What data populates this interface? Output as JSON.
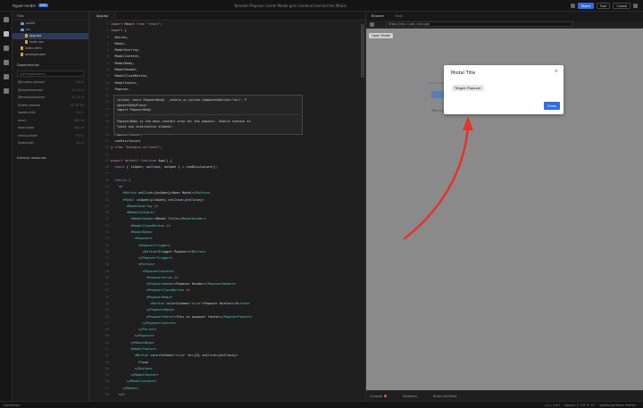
{
  "topbar": {
    "project": "Hyper-rendel",
    "badge": "DEV",
    "center_title": "Tomodel Popover inside Modal gets rendered behind the Modal",
    "share": "Share",
    "fork": "Fork",
    "create": "Create"
  },
  "sidebar": {
    "header": "Files",
    "tree": [
      {
        "label": "public",
        "type": "folder",
        "indent": 1
      },
      {
        "label": "src",
        "type": "folder",
        "indent": 1
      },
      {
        "label": "App.tsx",
        "type": "file",
        "indent": 2,
        "selected": true
      },
      {
        "label": "index.tsx",
        "type": "file",
        "indent": 2
      },
      {
        "label": "index.html",
        "type": "file",
        "indent": 1
      },
      {
        "label": "package.json",
        "type": "file",
        "indent": 1
      }
    ],
    "deps_header": "Dependencies",
    "deps_search_placeholder": "Add dependency",
    "deps": [
      {
        "name": "@chakra-ui/react",
        "ver": "2.8.2"
      },
      {
        "name": "@emotion/react",
        "ver": "11.11.0"
      },
      {
        "name": "@emotion/styled",
        "ver": "11.11.0"
      },
      {
        "name": "framer-motion",
        "ver": "10.12.16"
      },
      {
        "name": "loader-utils",
        "ver": "3.2.1"
      },
      {
        "name": "react",
        "ver": "18.2.0"
      },
      {
        "name": "react-dom",
        "ver": "18.2.0"
      },
      {
        "name": "react-scripts",
        "ver": "5.0.1"
      },
      {
        "name": "typescript",
        "ver": "4.4.2"
      }
    ],
    "external_header": "External resources"
  },
  "editor": {
    "tab": "App.tsx",
    "code_lines": [
      "import React from \"react\";",
      "import {",
      "  Button,",
      "  Modal,",
      "  ModalOverlay,",
      "  ModalContent,",
      "  ModalBody,",
      "  ModalHeader,",
      "  ModalCloseButton,",
      "  ModalFooter,",
      "  Popover,",
      "",
      "",
      "",
      "",
      "",
      "  PopoverBody,",
      "  PopoverFooter,",
      "  useDisclosure",
      "} from \"@chakra-ui/react\";",
      "",
      "export default function App() {",
      "  const { isOpen, onClose, onOpen } = useDisclosure();",
      "",
      "  return (",
      "    <>",
      "      <Button onClick={onOpen}>Open Modal</Button>",
      "      <Modal isOpen={isOpen} onClose={onClose}>",
      "        <ModalOverlay />",
      "        <ModalContent>",
      "          <ModalHeader>Modal Title</ModalHeader>",
      "          <ModalCloseButton />",
      "          <ModalBody>",
      "            <Popover>",
      "              <PopoverTrigger>",
      "                <Button>Trigger Popover</Button>",
      "              </PopoverTrigger>",
      "              <Portal>",
      "                <PopoverContent>",
      "                  <PopoverArrow />",
      "                  <PopoverHeader>Popover Header</PopoverHeader>",
      "                  <PopoverCloseButton />",
      "                  <PopoverBody>",
      "                    <Button colorScheme=\"blue\">Popover Button</Button>",
      "                  </PopoverBody>",
      "                  <PopoverFooter>This is popover footer</PopoverFooter>",
      "                </PopoverContent>",
      "              </Portal>",
      "            </Popover>",
      "          </ModalBody>",
      "          <ModalFooter>",
      "            <Button colorScheme=\"blue\" mr={3} onClick={onClose}>",
      "              Close",
      "            </Button>",
      "          </ModalFooter>",
      "        </ModalContent>",
      "      </Modal>",
      "    </>"
    ],
    "tooltip_lines": [
      "(alias) const PopoverBody: _chakra_ui_system.ComponentWithAs<\"div\", P",
      "opoverBodyProps>",
      "import PopoverBody",
      "PopoverBody is the main content area for the popover. Should contain at",
      "least one interactive element."
    ]
  },
  "preview": {
    "tabs": [
      "Browser",
      "Tests"
    ],
    "url": "https://csb-cl-abc.csb.app/",
    "open_modal_button": "Open Modal",
    "behind_text": "This is popover footer",
    "modal": {
      "title": "Modal Title",
      "close_glyph": "×",
      "trigger_button": "Trigger Popover",
      "close_button": "Close"
    },
    "status_items": [
      "Console",
      "Problems",
      "React DevTools"
    ],
    "console_count": "1"
  },
  "statusbar": {
    "left": "Connected",
    "items": [
      "Ln 1, Col 1",
      "Spaces: 2",
      "UTF-8",
      "LF",
      "TypeScript React",
      "Prettier"
    ]
  },
  "colors": {
    "accent": "#2f6fe0",
    "arrow": "#e5332a"
  }
}
